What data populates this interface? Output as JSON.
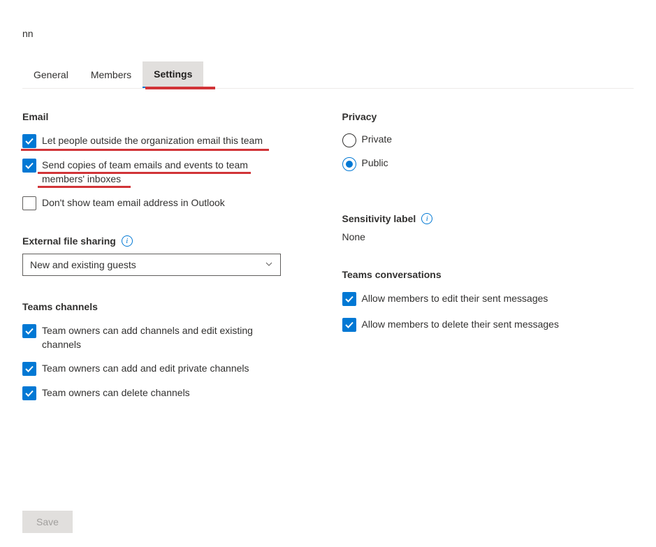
{
  "header": {
    "team_name": "nn"
  },
  "tabs": {
    "list": [
      {
        "label": "General",
        "active": false
      },
      {
        "label": "Members",
        "active": false
      },
      {
        "label": "Settings",
        "active": true
      }
    ]
  },
  "email": {
    "title": "Email",
    "options": {
      "outside_email": {
        "label": "Let people outside the organization email this team",
        "checked": true
      },
      "send_copies": {
        "label": "Send copies of team emails and events to team members' inboxes",
        "checked": true
      },
      "dont_show": {
        "label": "Don't show team email address in Outlook",
        "checked": false
      }
    }
  },
  "privacy": {
    "title": "Privacy",
    "options": {
      "private": {
        "label": "Private",
        "selected": false
      },
      "public": {
        "label": "Public",
        "selected": true
      }
    }
  },
  "external_sharing": {
    "title": "External file sharing",
    "selected": "New and existing guests"
  },
  "sensitivity": {
    "title": "Sensitivity label",
    "value": "None"
  },
  "teams_channels": {
    "title": "Teams channels",
    "options": {
      "add_edit": {
        "label": "Team owners can add channels and edit existing channels",
        "checked": true
      },
      "private": {
        "label": "Team owners can add and edit private channels",
        "checked": true
      },
      "delete": {
        "label": "Team owners can delete channels",
        "checked": true
      }
    }
  },
  "teams_conversations": {
    "title": "Teams conversations",
    "options": {
      "edit_sent": {
        "label": "Allow members to edit their sent messages",
        "checked": true
      },
      "delete_sent": {
        "label": "Allow members to delete their sent messages",
        "checked": true
      }
    }
  },
  "footer": {
    "save_label": "Save"
  }
}
